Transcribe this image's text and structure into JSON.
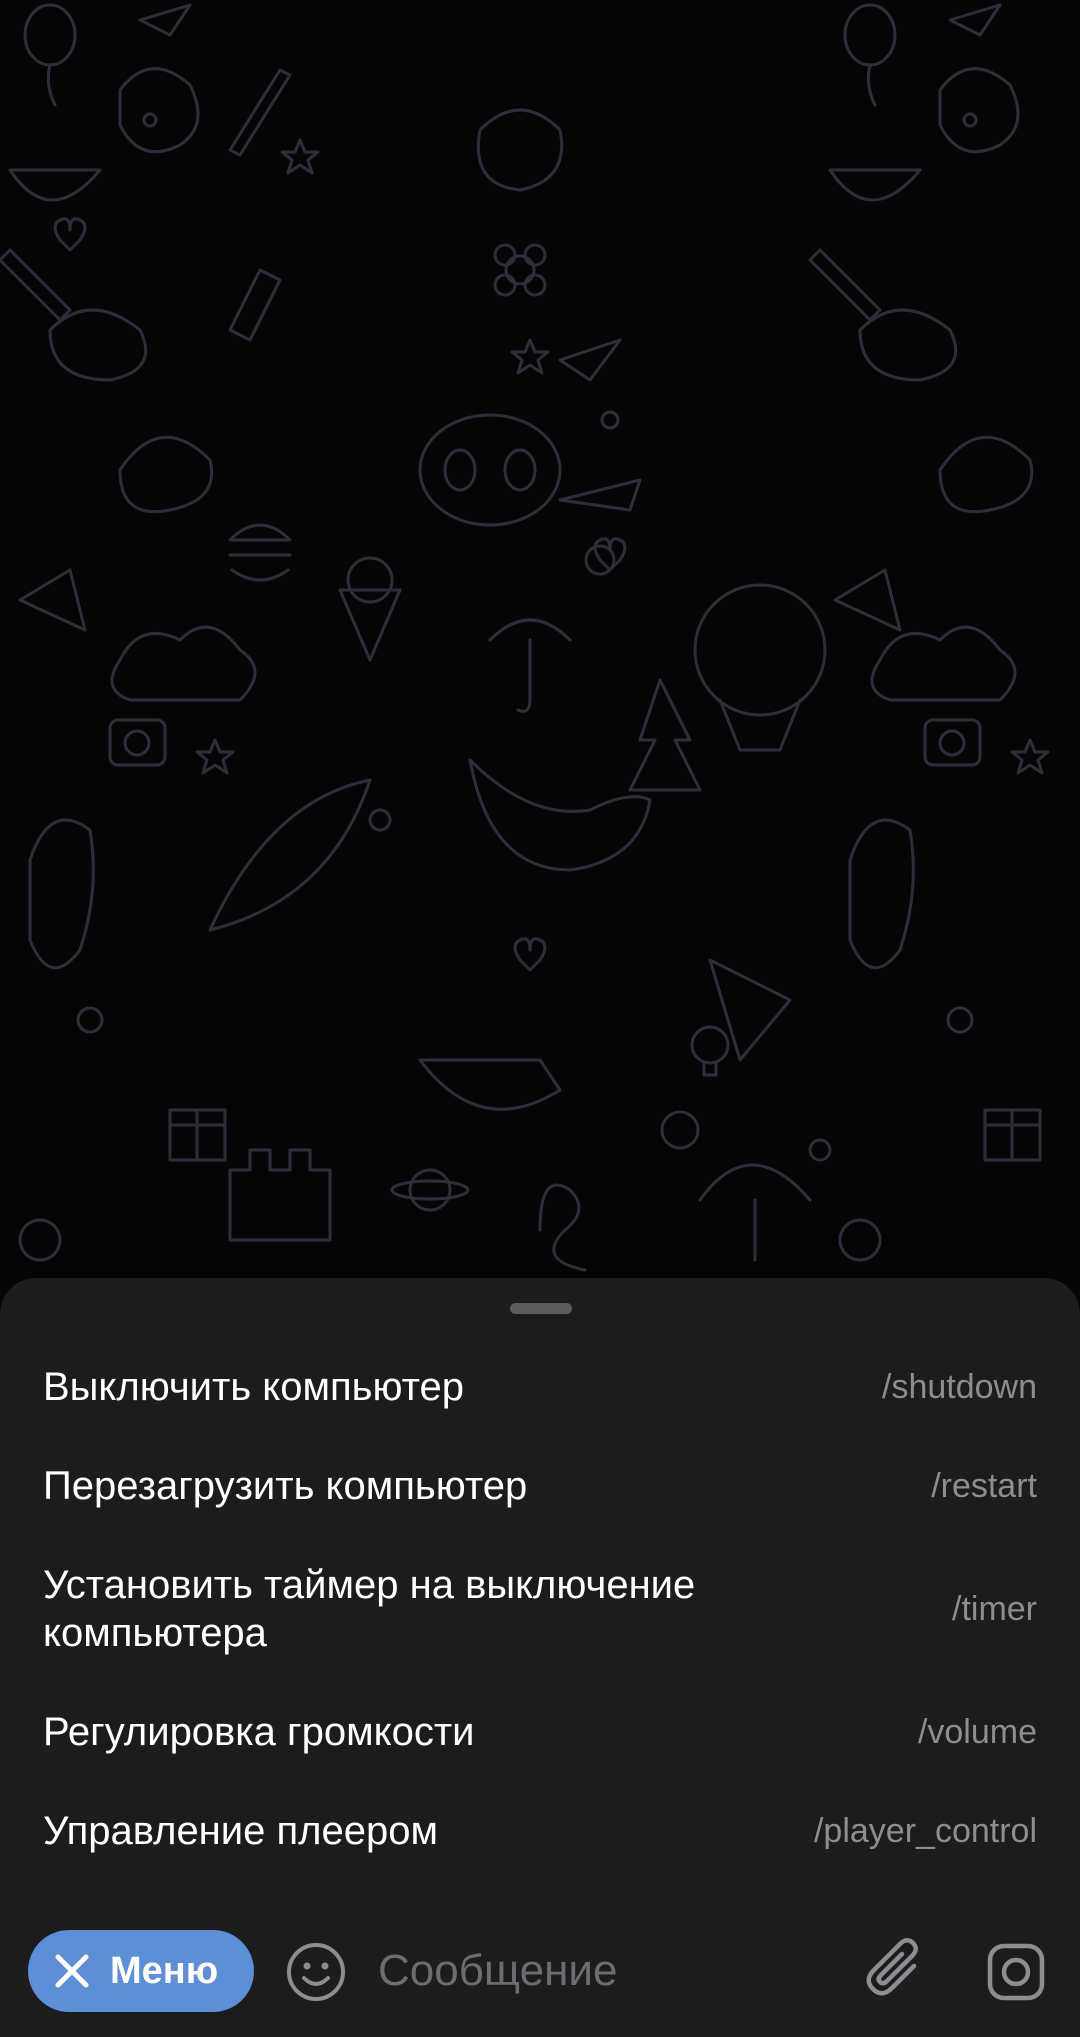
{
  "commands": [
    {
      "description": "Выключить компьютер",
      "command": "/shutdown"
    },
    {
      "description": "Перезагрузить компьютер",
      "command": "/restart"
    },
    {
      "description": "Установить таймер на выключение компьютера",
      "command": "/timer"
    },
    {
      "description": "Регулировка громкости",
      "command": "/volume"
    },
    {
      "description": "Управление плеером",
      "command": "/player_control"
    }
  ],
  "input_bar": {
    "menu_button_label": "Меню",
    "menu_button_icon": "close-icon",
    "message_placeholder": "Сообщение",
    "emoji_icon": "emoji-icon",
    "attach_icon": "paperclip-icon",
    "camera_icon": "instagram-camera-icon"
  },
  "colors": {
    "background": "#050505",
    "sheet": "#1c1c1d",
    "accent": "#5c8fd6",
    "command_text": "#8d8d92",
    "description_text": "#ffffff"
  }
}
